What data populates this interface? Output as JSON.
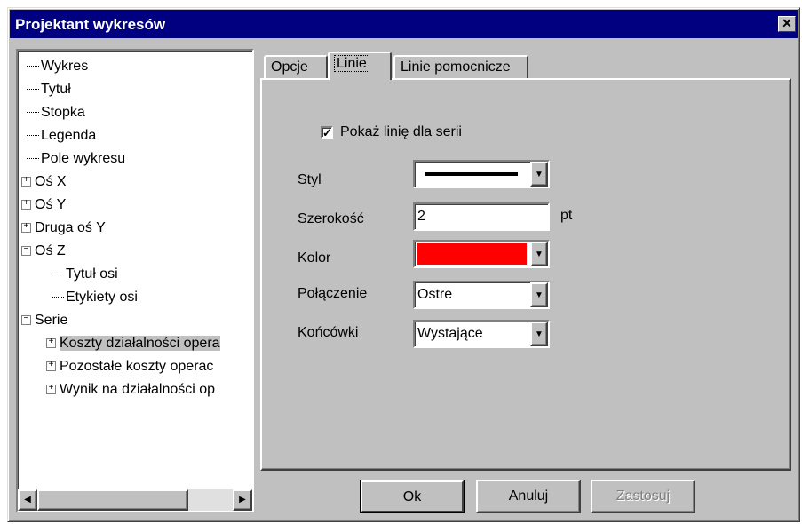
{
  "window": {
    "title": "Projektant wykresów",
    "close_glyph": "✕"
  },
  "tree": {
    "items": [
      {
        "label": "Wykres",
        "expander": ""
      },
      {
        "label": "Tytuł",
        "expander": ""
      },
      {
        "label": "Stopka",
        "expander": ""
      },
      {
        "label": "Legenda",
        "expander": ""
      },
      {
        "label": "Pole wykresu",
        "expander": ""
      },
      {
        "label": "Oś X",
        "expander": "+"
      },
      {
        "label": "Oś Y",
        "expander": "+"
      },
      {
        "label": "Druga oś Y",
        "expander": "+"
      },
      {
        "label": "Oś Z",
        "expander": "−"
      },
      {
        "label": "Tytuł osi",
        "expander": ""
      },
      {
        "label": "Etykiety osi",
        "expander": ""
      },
      {
        "label": "Serie",
        "expander": "−"
      },
      {
        "label": "Koszty działalności opera",
        "expander": "+"
      },
      {
        "label": "Pozostałe koszty operac",
        "expander": "+"
      },
      {
        "label": "Wynik na działalności op",
        "expander": "+"
      }
    ],
    "scroll_left_glyph": "◀",
    "scroll_right_glyph": "▶"
  },
  "tabs": [
    {
      "label": "Opcje"
    },
    {
      "label": "Linie"
    },
    {
      "label": "Linie pomocnicze"
    }
  ],
  "lines_panel": {
    "show_line": {
      "label": "Pokaż linię dla serii",
      "checked_glyph": "✓"
    },
    "style": {
      "label": "Styl"
    },
    "width": {
      "label": "Szerokość",
      "value": "2",
      "unit": "pt"
    },
    "color": {
      "label": "Kolor",
      "value_color": "#ff0000"
    },
    "join": {
      "label": "Połączenie",
      "value": "Ostre"
    },
    "caps": {
      "label": "Końcówki",
      "value": "Wystające"
    },
    "dropdown_glyph": "▼"
  },
  "buttons": {
    "ok": "Ok",
    "cancel": "Anuluj",
    "apply": "Zastosuj"
  }
}
